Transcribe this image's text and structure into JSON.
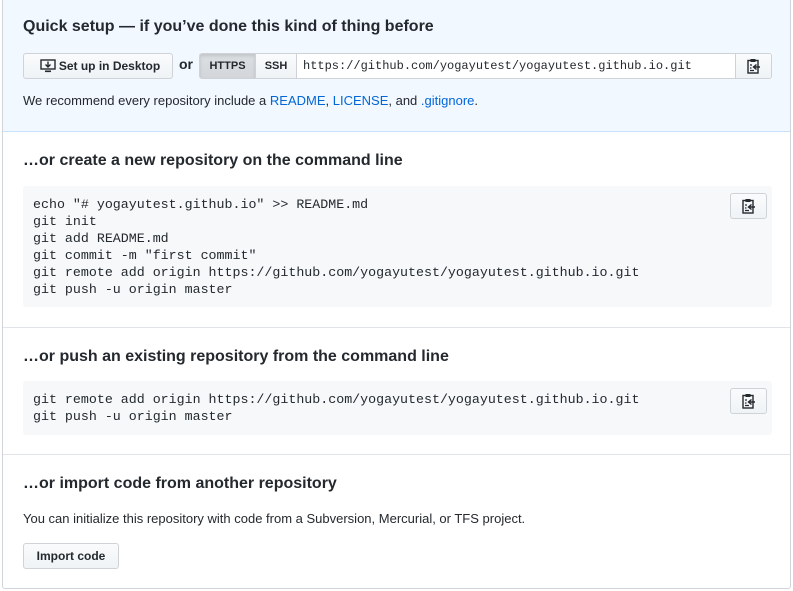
{
  "quick_setup": {
    "title": "Quick setup — if you’ve done this kind of thing before",
    "desktop_button": "Set up in Desktop",
    "or_label": "or",
    "protocols": [
      "HTTPS",
      "SSH"
    ],
    "selected_protocol": "HTTPS",
    "clone_url": "https://github.com/yogayutest/yogayutest.github.io.git",
    "recommend": {
      "prefix": "We recommend every repository include a ",
      "readme": "README",
      "sep1": ", ",
      "license": "LICENSE",
      "sep2": ", and ",
      "gitignore": ".gitignore",
      "suffix": "."
    }
  },
  "create_repo": {
    "title": "…or create a new repository on the command line",
    "lines": [
      "echo \"# yogayutest.github.io\" >> README.md",
      "git init",
      "git add README.md",
      "git commit -m \"first commit\"",
      "git remote add origin https://github.com/yogayutest/yogayutest.github.io.git",
      "git push -u origin master"
    ]
  },
  "push_repo": {
    "title": "…or push an existing repository from the command line",
    "lines": [
      "git remote add origin https://github.com/yogayutest/yogayutest.github.io.git",
      "git push -u origin master"
    ]
  },
  "import_repo": {
    "title": "…or import code from another repository",
    "description": "You can initialize this repository with code from a Subversion, Mercurial, or TFS project.",
    "button": "Import code"
  },
  "icons": {
    "desktop": "desktop-download-icon",
    "copy": "clippy-icon"
  },
  "colors": {
    "link": "#0366d6",
    "quick_bg": "#f1f8ff",
    "code_bg": "#f6f8fa"
  }
}
